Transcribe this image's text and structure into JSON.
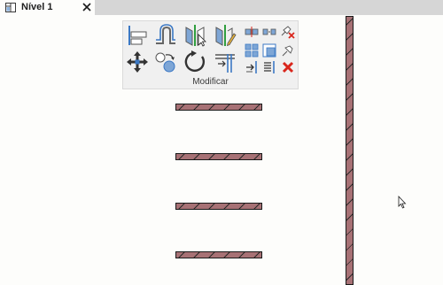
{
  "view_tab": {
    "title": "Nível 1",
    "icon": "floor-plan-icon",
    "close_icon": "close-icon"
  },
  "ribbon": {
    "panel_label": "Modificar",
    "tools": [
      "align-icon",
      "offset-icon",
      "mirror-pick-axis-icon",
      "mirror-draw-axis-icon",
      "split-element-icon",
      "split-with-gap-icon",
      "unpin-icon",
      "move-icon",
      "copy-icon",
      "rotate-icon",
      "trim-extend-to-corner-icon",
      "array-icon",
      "scale-icon",
      "pin-icon",
      "trim-extend-single-icon",
      "trim-extend-multiple-icon",
      "delete-icon"
    ]
  },
  "colors": {
    "wall_fill": "#a77175",
    "wall_hatch": "#2b2b2b",
    "delete_red": "#d9261c",
    "accent_blue": "#3b78c4",
    "tab_strip": "#d6d6d6",
    "canvas": "#fdfdfb"
  }
}
